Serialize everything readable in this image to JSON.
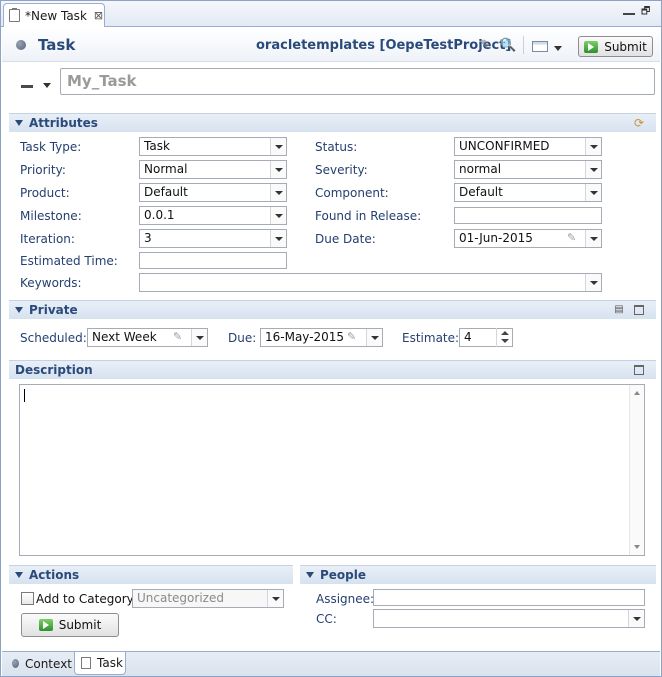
{
  "tab": {
    "title": "*New Task",
    "close": "⊠"
  },
  "header": {
    "title": "Task",
    "project": "oracletemplates [OepeTestProject]",
    "submit_label": "Submit"
  },
  "summary": {
    "placeholder": "My_Task"
  },
  "attributes": {
    "title": "Attributes",
    "left": [
      {
        "label": "Task Type:",
        "value": "Task",
        "type": "combo"
      },
      {
        "label": "Priority:",
        "value": "Normal",
        "type": "combo"
      },
      {
        "label": "Product:",
        "value": "Default",
        "type": "combo"
      },
      {
        "label": "Milestone:",
        "value": "0.0.1",
        "type": "combo"
      },
      {
        "label": "Iteration:",
        "value": "3",
        "type": "combo"
      },
      {
        "label": "Estimated Time:",
        "value": "",
        "type": "text"
      }
    ],
    "right": [
      {
        "label": "Status:",
        "value": "UNCONFIRMED",
        "type": "combo"
      },
      {
        "label": "Severity:",
        "value": "normal",
        "type": "combo"
      },
      {
        "label": "Component:",
        "value": "Default",
        "type": "combo"
      },
      {
        "label": "Found in Release:",
        "value": "",
        "type": "text"
      },
      {
        "label": "Due Date:",
        "value": "01-Jun-2015",
        "type": "date"
      }
    ],
    "keywords": {
      "label": "Keywords:",
      "value": ""
    }
  },
  "private": {
    "title": "Private",
    "scheduled_label": "Scheduled:",
    "scheduled_value": "Next Week",
    "due_label": "Due:",
    "due_value": "16-May-2015 0",
    "estimate_label": "Estimate:",
    "estimate_value": "4"
  },
  "description": {
    "title": "Description",
    "value": ""
  },
  "actions": {
    "title": "Actions",
    "add_to_category_label": "Add to Category",
    "category_value": "Uncategorized",
    "submit_label": "Submit"
  },
  "people": {
    "title": "People",
    "assignee_label": "Assignee:",
    "assignee_value": "",
    "cc_label": "CC:",
    "cc_value": ""
  },
  "bottom_tabs": [
    {
      "label": "Context"
    },
    {
      "label": "Task"
    }
  ],
  "colors": {
    "section_text": "#2a4a7a",
    "label_text": "#243f70",
    "border": "#9aaecf"
  }
}
